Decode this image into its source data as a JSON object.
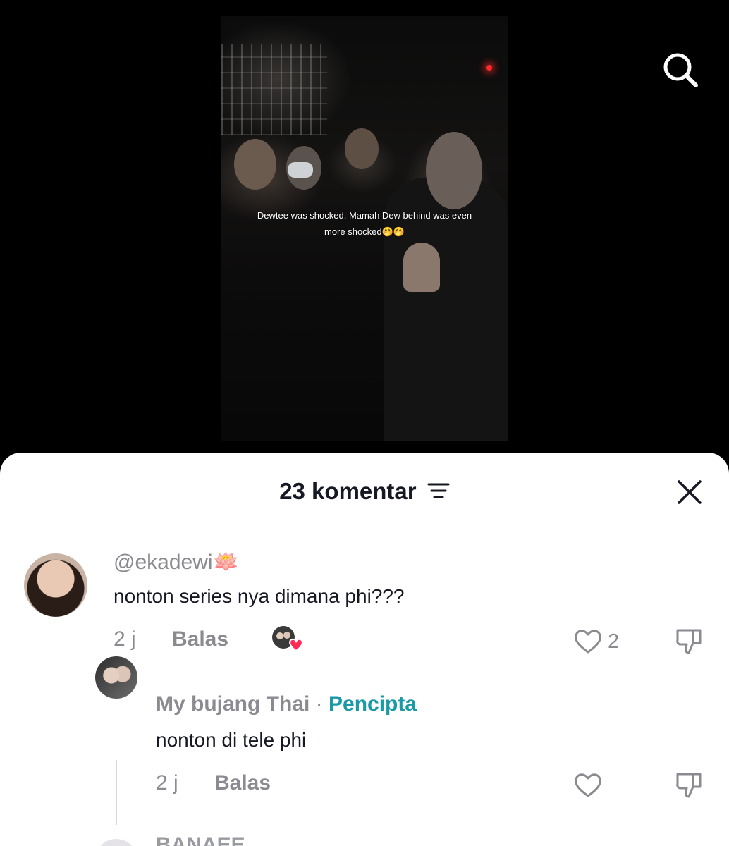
{
  "video": {
    "caption_line1": "Dewtee was shocked, Mamah Dew behind was even",
    "caption_line2": "more shocked🤭🤭"
  },
  "comments_panel": {
    "title": "23 komentar",
    "comments": [
      {
        "username": "@ekadewi🪷",
        "text": "nonton series nya dimana phi???",
        "time": "2 j",
        "reply_label": "Balas",
        "likes": "2"
      },
      {
        "username": "My bujang Thai",
        "separator": " · ",
        "badge": "Pencipta",
        "text": "nonton di tele phi",
        "time": "2 j",
        "reply_label": "Balas"
      },
      {
        "username": "BANAEE"
      }
    ]
  },
  "icons": {
    "search": "search-icon",
    "filter": "filter-icon",
    "close": "close-icon",
    "like": "heart-icon",
    "dislike": "thumbs-down-icon"
  },
  "colors": {
    "creator_badge": "#1a9aa7",
    "liked_heart": "#fe2c55",
    "muted_text": "#8a8b91"
  }
}
